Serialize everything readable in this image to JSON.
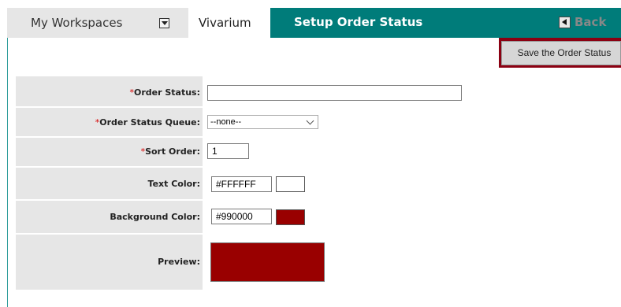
{
  "tabs": {
    "workspaces": "My Workspaces",
    "vivarium": "Vivarium"
  },
  "header": {
    "title": "Setup Order Status",
    "back_label": "Back"
  },
  "toolbar": {
    "save_label": "Save the Order Status"
  },
  "form": {
    "order_status": {
      "label": "Order Status:",
      "value": ""
    },
    "queue": {
      "label": "Order Status Queue:",
      "value": "--none--"
    },
    "sort_order": {
      "label": "Sort Order:",
      "value": "1"
    },
    "text_color": {
      "label": "Text Color:",
      "value": "#FFFFFF"
    },
    "background_color": {
      "label": "Background Color:",
      "value": "#990000"
    },
    "preview": {
      "label": "Preview:"
    }
  },
  "required_marker": "*",
  "colors": {
    "teal": "#007c7a",
    "save_bar": "#8b0012",
    "text_color": "#FFFFFF",
    "background_color": "#990000"
  },
  "icons": {
    "workspace_dropdown": "chevron-down-icon",
    "back": "arrow-left-icon",
    "select_chevron": "chevron-down-icon"
  }
}
